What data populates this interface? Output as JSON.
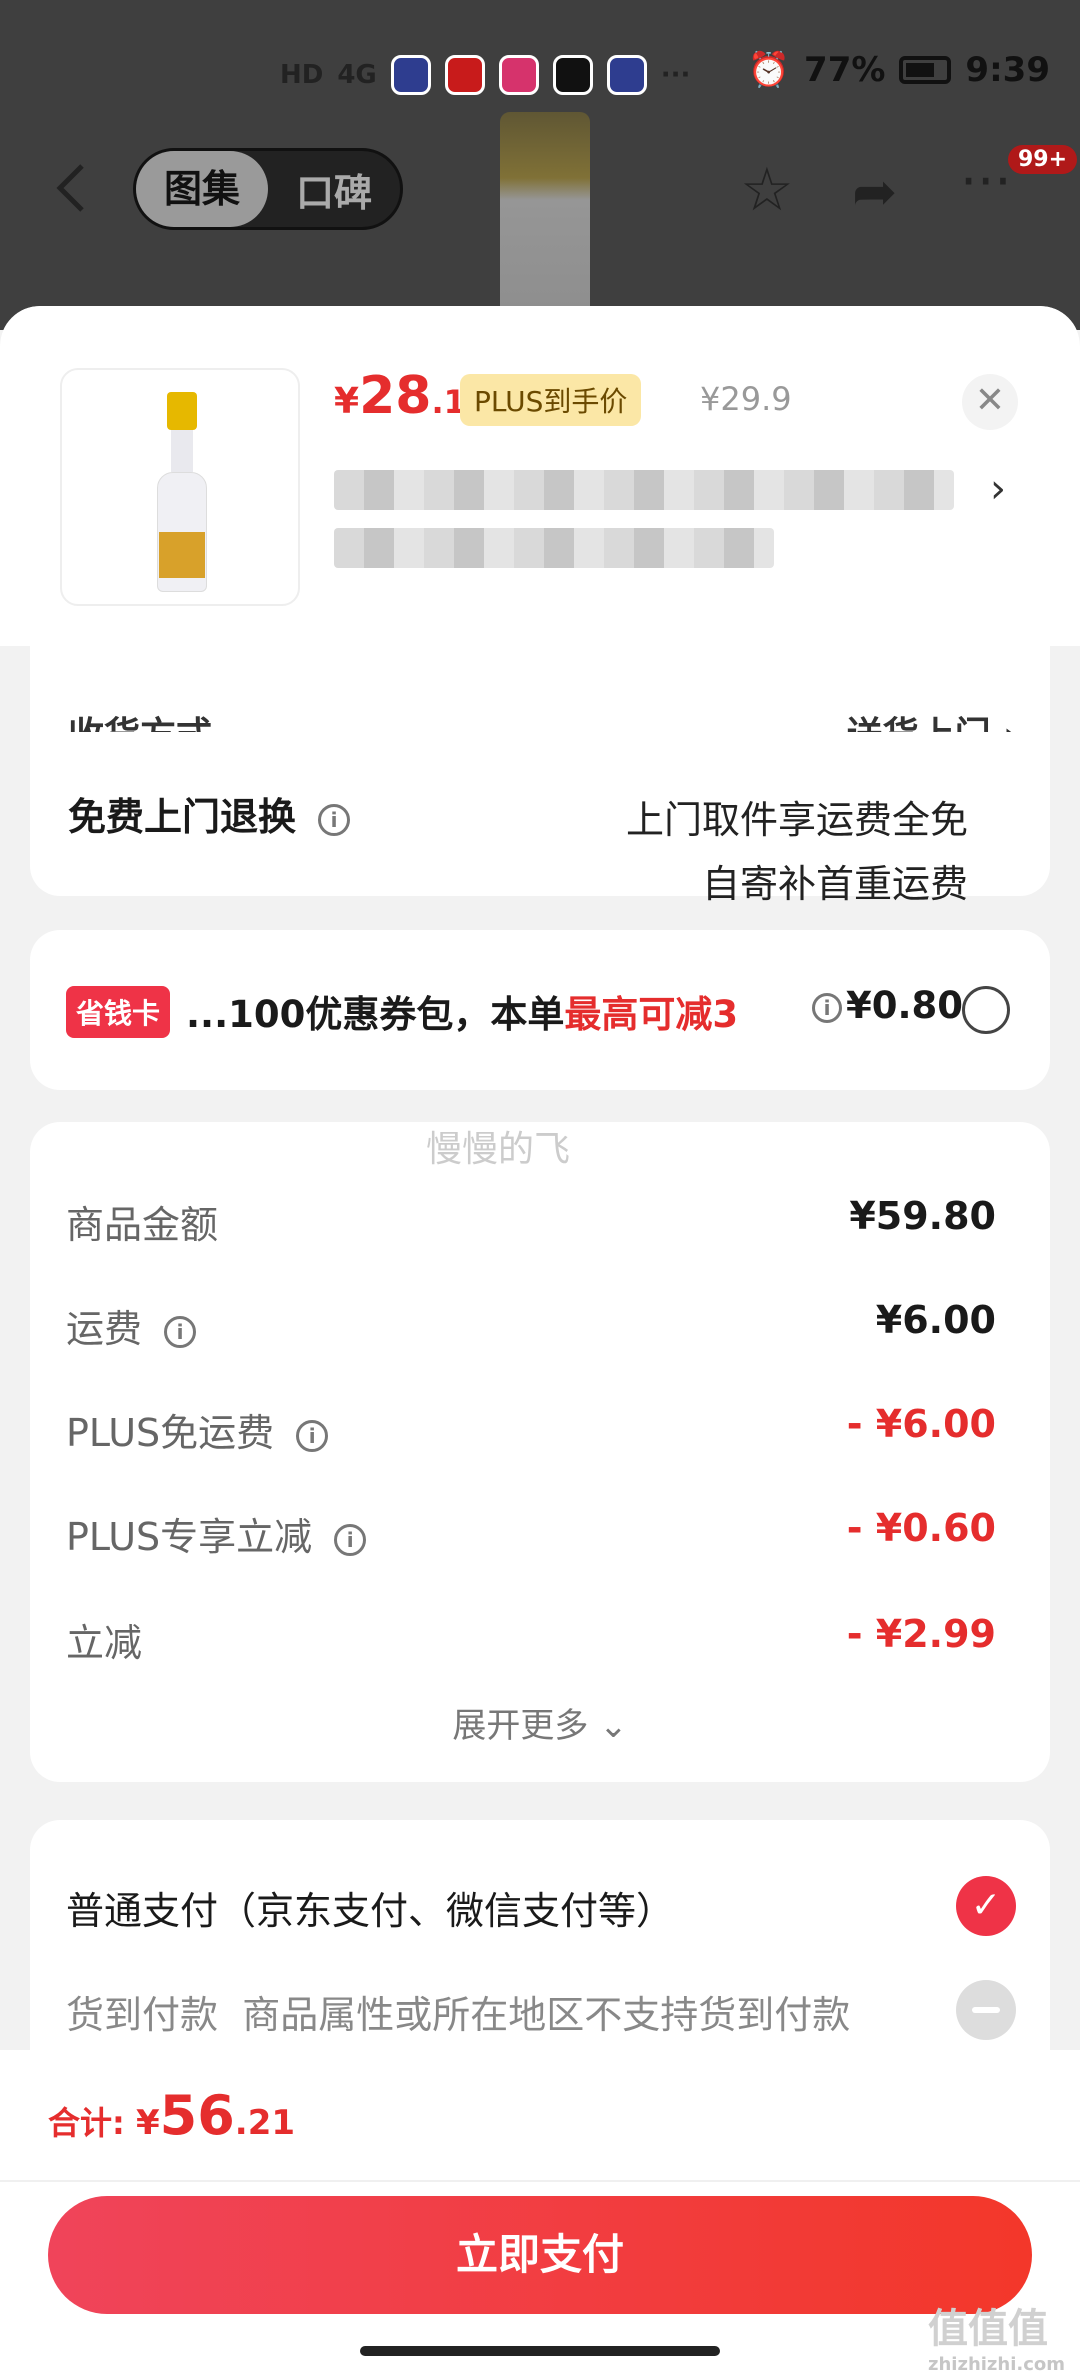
{
  "status_bar": {
    "network": "HD",
    "signal": "4G",
    "more": "···",
    "battery": "77%",
    "time": "9:39"
  },
  "nav": {
    "tabs": [
      "图集",
      "口碑"
    ],
    "badge": "99+"
  },
  "product": {
    "price_symbol": "¥",
    "price_int": "28",
    "price_dec": ".1",
    "plus_tag": "PLUS到手价",
    "original_price": "¥29.9"
  },
  "delivery": {
    "cut_label": "收货方式",
    "cut_value": "送货上门 ›",
    "return_label": "免费上门退换",
    "return_line1": "上门取件享运费全免",
    "return_line2": "自寄补首重运费"
  },
  "promo": {
    "tag": "省钱卡",
    "text_prefix": "...100优惠券包，本单",
    "text_highlight": "最高可减3",
    "price": "¥0.80"
  },
  "watermark": "慢慢的飞",
  "fees": [
    {
      "label": "商品金额",
      "value": "¥59.80",
      "info": false,
      "red": false
    },
    {
      "label": "运费",
      "value": "¥6.00",
      "info": true,
      "red": false
    },
    {
      "label": "PLUS免运费",
      "value": "- ¥6.00",
      "info": true,
      "red": true
    },
    {
      "label": "PLUS专享立减",
      "value": "- ¥0.60",
      "info": true,
      "red": true
    },
    {
      "label": "立减",
      "value": "- ¥2.99",
      "info": false,
      "red": true
    }
  ],
  "expand_label": "展开更多 ⌄",
  "payment": {
    "option1": "普通支付（京东支付、微信支付等）",
    "option2_label": "货到付款",
    "option2_note": "商品属性或所在地区不支持货到付款"
  },
  "footer": {
    "total_label": "合计: ",
    "total_symbol": "¥",
    "total_int": "56",
    "total_dec": ".21",
    "pay_button": "立即支付"
  },
  "corner_mark": {
    "main": "值值值",
    "sub": "zhizhizhi.com"
  },
  "colors": {
    "accent_red": "#e52d2d",
    "plus_gold": "#fbe7a6",
    "tag_red": "#ef3347"
  }
}
